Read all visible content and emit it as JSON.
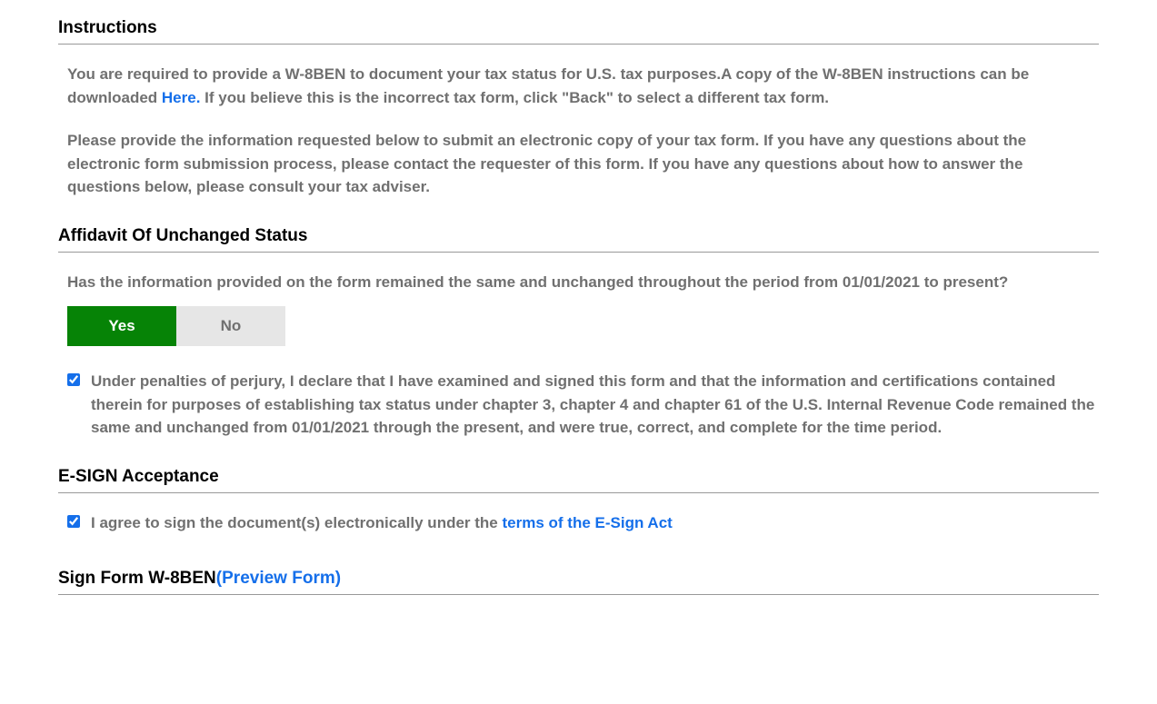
{
  "instructions": {
    "heading": "Instructions",
    "para1_before": "You are required to provide a W-8BEN to document your tax status for U.S. tax purposes.A copy of the W-8BEN instructions can be downloaded ",
    "para1_link": "Here.",
    "para1_after": " If you believe this is the incorrect tax form, click \"Back\" to select a different tax form.",
    "para2": "Please provide the information requested below to submit an electronic copy of your tax form. If you have any questions about the electronic form submission process, please contact the requester of this form. If you have any questions about how to answer the questions below, please consult your tax adviser."
  },
  "affidavit": {
    "heading": "Affidavit Of Unchanged Status",
    "question": "Has the information provided on the form remained the same and unchanged throughout the period from 01/01/2021 to present?",
    "yes_label": "Yes",
    "no_label": "No",
    "perjury_text": "Under penalties of perjury, I declare that I have examined and signed this form and that the information and certifications contained therein for purposes of establishing tax status under chapter 3, chapter 4 and chapter 61 of the U.S. Internal Revenue Code remained the same and unchanged from 01/01/2021 through the present, and were true, correct, and complete for the time period."
  },
  "esign": {
    "heading": "E-SIGN Acceptance",
    "agree_before": "I agree to sign the document(s) electronically under the ",
    "agree_link": "terms of the E-Sign Act"
  },
  "sign": {
    "heading_text": "Sign Form W-8BEN",
    "preview_link": "(Preview Form)"
  }
}
